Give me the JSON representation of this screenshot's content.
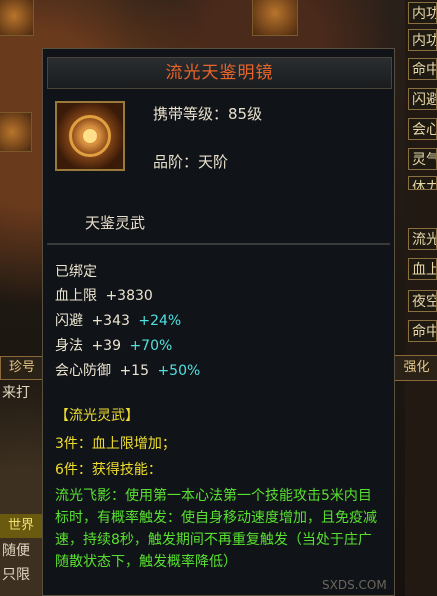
{
  "background": {
    "left_tab": "珍号",
    "left_lines": [
      "来打",
      "随便",
      "只限"
    ],
    "world_tab": "世界",
    "right_tabs": [
      "内功",
      "内功",
      "命中",
      "闪避",
      "会心",
      "灵气",
      "体力"
    ],
    "right_tabs_lower": [
      "流光",
      "血上",
      "夜空",
      "命中"
    ],
    "enhance_tab": "强化"
  },
  "tooltip": {
    "title": "流光天鉴明镜",
    "level": "携带等级：85级",
    "grade": "品阶：天阶",
    "subtitle": "天鉴灵武",
    "bound": "已绑定",
    "stats": [
      {
        "name": "血上限",
        "value": "+3830",
        "pct": ""
      },
      {
        "name": "闪避",
        "value": "+343",
        "pct": "+24%"
      },
      {
        "name": "身法",
        "value": "+39",
        "pct": "+70%"
      },
      {
        "name": "会心防御",
        "value": "+15",
        "pct": "+50%"
      }
    ],
    "set_name": "【流光灵武】",
    "set_3": "3件：血上限增加；",
    "set_6": "6件：获得技能：",
    "skill_desc": "流光飞影：使用第一本心法第一个技能攻击5米内目标时，有概率触发：使自身移动速度增加，且免疫减速，持续8秒，触发期间不再重复触发（当处于庄广随散状态下，触发概率降低）",
    "colors": {
      "title": "#e8642a",
      "stat_pct": "#4fe0e0",
      "set": "#f0dd30",
      "skill": "#58e030"
    },
    "icon": "mirror-icon"
  },
  "watermark": "SXDS.COM"
}
